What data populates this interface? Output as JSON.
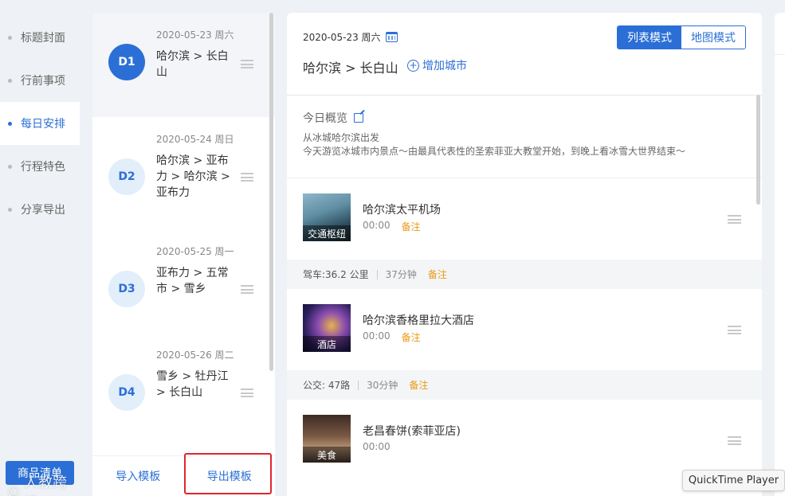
{
  "nav": {
    "items": [
      {
        "label": "标题封面",
        "active": false
      },
      {
        "label": "行前事项",
        "active": false
      },
      {
        "label": "每日安排",
        "active": true
      },
      {
        "label": "行程特色",
        "active": false
      },
      {
        "label": "分享导出",
        "active": false
      }
    ],
    "goods_button": "商品清单",
    "watermark": "人教跨境"
  },
  "days": [
    {
      "badge": "D1",
      "date": "2020-05-23 周六",
      "route": "哈尔滨 > 长白山",
      "active": true
    },
    {
      "badge": "D2",
      "date": "2020-05-24 周日",
      "route": "哈尔滨 > 亚布力 > 哈尔滨 > 亚布力",
      "active": false
    },
    {
      "badge": "D3",
      "date": "2020-05-25 周一",
      "route": "亚布力 > 五常市 > 雪乡",
      "active": false
    },
    {
      "badge": "D4",
      "date": "2020-05-26 周二",
      "route": "雪乡 > 牡丹江 > 长白山",
      "active": false
    }
  ],
  "days_footer": {
    "import_label": "导入模板",
    "export_label": "导出模板"
  },
  "main": {
    "date": "2020-05-23 周六",
    "route": "哈尔滨 > 长白山",
    "add_city_label": "增加城市",
    "modes": {
      "list_label": "列表模式",
      "map_label": "地图模式",
      "active": "list"
    },
    "overview": {
      "title": "今日概览",
      "line1": "从冰城哈尔滨出发",
      "line2": "今天游览冰城市内景点～由最具代表性的圣索菲亚大教堂开始，到晚上看冰雪大世界结束～"
    },
    "pois": [
      {
        "name": "哈尔滨太平机场",
        "category": "交通枢纽",
        "time": "00:00",
        "note": "备注"
      },
      {
        "name": "哈尔滨香格里拉大酒店",
        "category": "酒店",
        "time": "00:00",
        "note": "备注"
      },
      {
        "name": "老昌春饼(索菲亚店)",
        "category": "美食",
        "time": "00:00",
        "note": ""
      }
    ],
    "transits": [
      {
        "mode": "驾车:36.2 公里",
        "duration": "37分钟",
        "note": "备注"
      },
      {
        "mode": "公交: 47路",
        "duration": "30分钟",
        "note": "备注"
      }
    ]
  },
  "tooltip": "QuickTime Player",
  "colors": {
    "accent": "#2b6fd6",
    "note": "#e89a16",
    "highlight_box": "#e0262b"
  }
}
